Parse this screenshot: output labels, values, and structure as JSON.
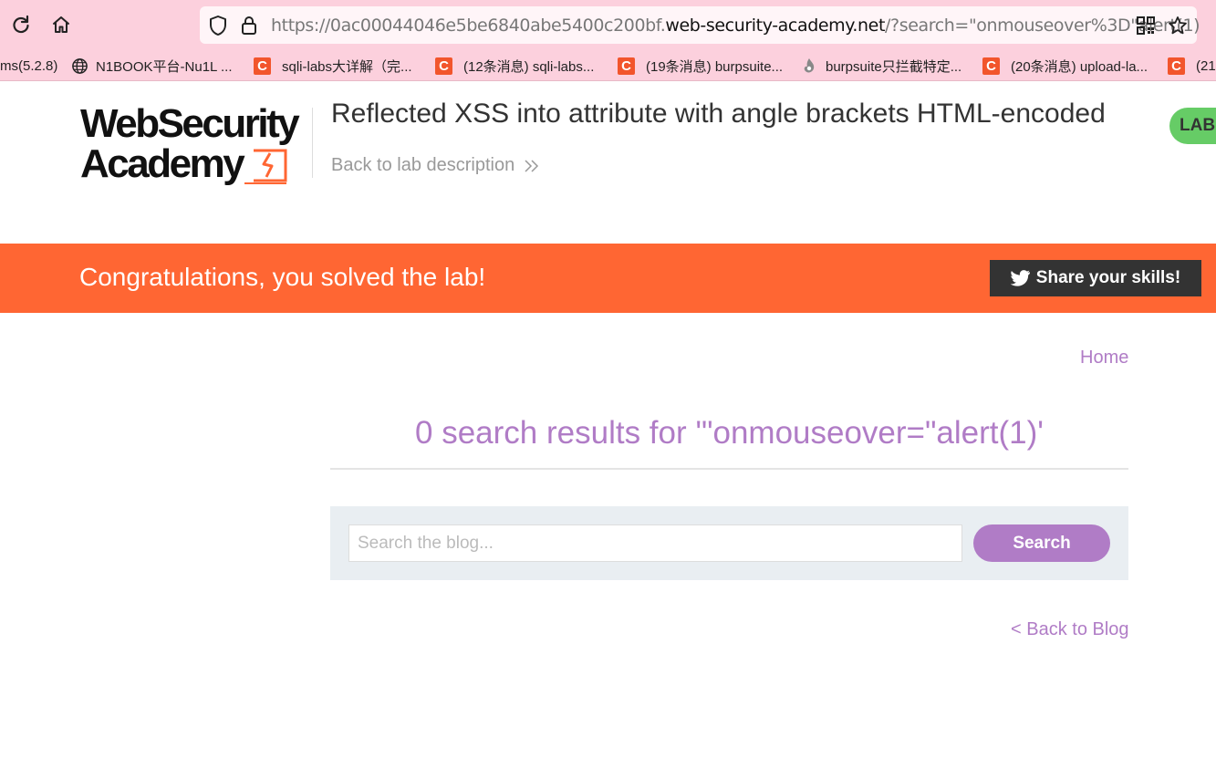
{
  "browser": {
    "url_prefix": "https://0ac00044046e5be6840abe5400c200bf.",
    "url_domain": "web-security-academy.net",
    "url_suffix": "/?search=\"onmouseover%3D\"alert(1)",
    "icons": [
      "reload-icon",
      "home-icon",
      "shield-icon",
      "lock-icon",
      "qr-code-icon",
      "star-icon"
    ],
    "bookmarks": [
      {
        "label": "ms(5.2.8)",
        "icon": "none"
      },
      {
        "label": "N1BOOK平台-Nu1L ...",
        "icon": "globe-icon"
      },
      {
        "label": "sqli-labs大详解（完...",
        "icon": "csdn-icon"
      },
      {
        "label": "(12条消息) sqli-labs...",
        "icon": "csdn-icon"
      },
      {
        "label": "(19条消息) burpsuite...",
        "icon": "csdn-icon"
      },
      {
        "label": "burpsuite只拦截特定...",
        "icon": "flame-icon"
      },
      {
        "label": "(20条消息) upload-la...",
        "icon": "csdn-icon"
      },
      {
        "label": "(21",
        "icon": "csdn-icon"
      }
    ],
    "accent_color": "#fcd0dd"
  },
  "header": {
    "logo_line1": "WebSecurity",
    "logo_line2": "Academy",
    "lab_title": "Reflected XSS into attribute with angle brackets HTML-encoded",
    "back_to_lab": "Back to lab description",
    "lab_status": "LAB"
  },
  "banner": {
    "message": "Congratulations, you solved the lab!",
    "share_label": "Share your skills!",
    "color": "#ff6633"
  },
  "nav": {
    "home": "Home"
  },
  "results": {
    "heading": "0 search results for '\"onmouseover=\"alert(1)'"
  },
  "search": {
    "placeholder": "Search the blog...",
    "value": "",
    "button_label": "Search"
  },
  "footer": {
    "back_to_blog": "< Back to Blog"
  },
  "colors": {
    "link": "#b07cc6",
    "badge": "#66cc66"
  }
}
